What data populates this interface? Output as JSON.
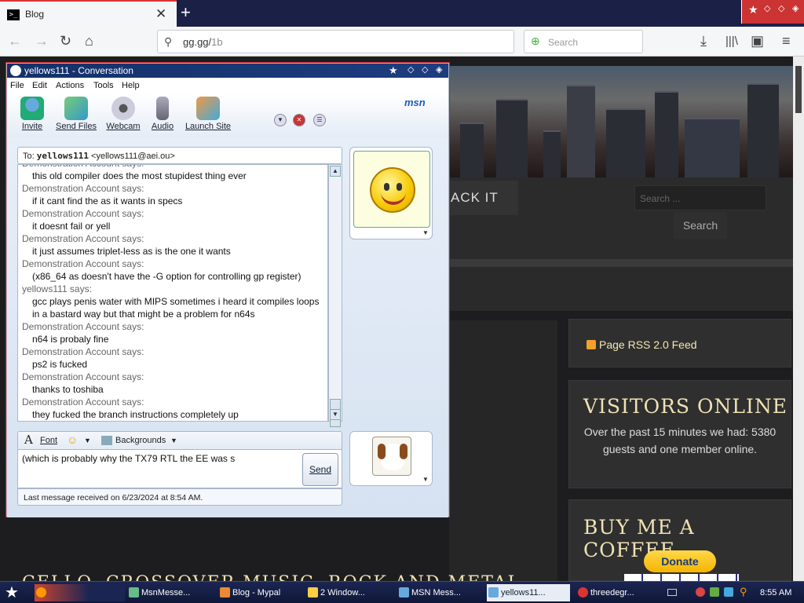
{
  "browser": {
    "tab_title": "Blog",
    "tab_close": "✕",
    "new_tab": "+",
    "url_host": "gg.gg/",
    "url_path": "1b",
    "search_placeholder": "Search"
  },
  "page": {
    "back_it": "ACK IT",
    "search_placeholder": "Search ...",
    "search_button": "Search",
    "rss_label": "Page RSS 2.0 Feed",
    "visitors_title": "VISITORS ONLINE",
    "visitors_body": "Over the past 15 minutes we had: 5380 guests and one member online.",
    "coffee_title": "BUY ME A COFFEE",
    "donate_label": "Donate",
    "bottom_heading": "CELLO, CROSSOVER MUSIC, ROCK AND METAL"
  },
  "msn": {
    "window_title": "yellows111 - Conversation",
    "menu": [
      "File",
      "Edit",
      "Actions",
      "Tools",
      "Help"
    ],
    "tools": [
      {
        "label": "Invite",
        "icon": "invite-icon"
      },
      {
        "label": "Send Files",
        "icon": "send-files-icon"
      },
      {
        "label": "Webcam",
        "icon": "webcam-icon"
      },
      {
        "label": "Audio",
        "icon": "audio-icon"
      },
      {
        "label": "Launch Site",
        "icon": "launch-site-icon"
      }
    ],
    "logo": "msn",
    "to_prefix": "To:",
    "to_name": "yellows111",
    "to_email": "<yellows111@aei.ou>",
    "messages": [
      {
        "who": "Demonstration Account says:",
        "text": "this old compiler does the most stupidest thing ever"
      },
      {
        "who": "Demonstration Account says:",
        "text": "if it cant find the as it wants in specs"
      },
      {
        "who": "Demonstration Account says:",
        "text": "it doesnt fail or yell"
      },
      {
        "who": "Demonstration Account says:",
        "text": "it just assumes triplet-less as is the one it wants"
      },
      {
        "who": "Demonstration Account says:",
        "text": "(x86_64 as doesn't have the -G option for controlling gp register)"
      },
      {
        "who": "yellows111 says:",
        "text": "gcc plays penis water with MIPS sometimes i heard it compiles loops in a bastard way but that might be a problem for n64s"
      },
      {
        "who": "Demonstration Account says:",
        "text": "n64 is probaly fine"
      },
      {
        "who": "Demonstration Account says:",
        "text": "ps2 is fucked"
      },
      {
        "who": "Demonstration Account says:",
        "text": "thanks to toshiba"
      },
      {
        "who": "Demonstration Account says:",
        "text": "they fucked the branch instructions completely up"
      }
    ],
    "font_label": "Font",
    "backgrounds_label": "Backgrounds",
    "input_text": "(which is probably why the TX79 RTL the EE was s",
    "send_label": "Send",
    "status": "Last message received on 6/23/2024 at 8:54 AM."
  },
  "taskbar": {
    "tasks": [
      "",
      "MsnMesse...",
      "Blog - Mypal",
      "2 Window...",
      "MSN Mess...",
      "yellows11...",
      "threedegr..."
    ],
    "clock": "8:55 AM"
  }
}
